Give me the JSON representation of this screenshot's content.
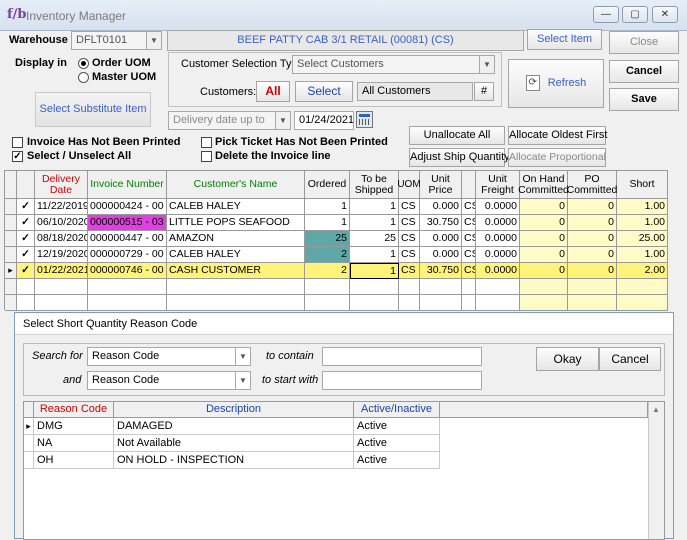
{
  "window": {
    "logo": "f/b",
    "title": "Inventory Manager",
    "minimize": "—",
    "maximize": "▢",
    "close": "✕"
  },
  "warehouse": {
    "label": "Warehouse",
    "value": "DFLT0101"
  },
  "item_title": "BEEF PATTY CAB 3/1 RETAIL (00081) (CS)",
  "buttons": {
    "select_item": "Select Item",
    "close": "Close",
    "cancel": "Cancel",
    "save": "Save",
    "refresh": "Refresh",
    "select_substitute": "Select Substitute Item",
    "unallocate_all": "Unallocate All",
    "allocate_oldest": "Allocate Oldest First",
    "adjust_ship_qty": "Adjust Ship Quantity",
    "allocate_proportional": "Allocate Proportional",
    "all": "All",
    "select": "Select",
    "hash": "#"
  },
  "display_in": {
    "label": "Display in",
    "opt1": "Order UOM",
    "opt2": "Master UOM"
  },
  "customer_selection": {
    "label": "Customer Selection Type",
    "value": "Select Customers"
  },
  "customers": {
    "label": "Customers:",
    "value": "All Customers"
  },
  "delivery_date": {
    "placeholder": "Delivery date up to",
    "value": "01/24/2021"
  },
  "checks": {
    "invoice_not_printed": "Invoice Has Not Been Printed",
    "select_unselect_all": "Select / Unselect All",
    "pick_ticket_not_printed": "Pick Ticket Has Not Been Printed",
    "delete_invoice_line": "Delete the Invoice line"
  },
  "grid": {
    "headers": {
      "delivery_date": "Delivery Date",
      "invoice_number": "Invoice Number",
      "customer_name": "Customer's Name",
      "ordered": "Ordered",
      "to_be_shipped": "To be Shipped",
      "uom": "UOM",
      "unit_price": "Unit Price",
      "unit_freight": "Unit Freight",
      "on_hand_committed": "On Hand Committed",
      "po_committed": "PO Committed",
      "short": "Short"
    },
    "rows": [
      {
        "check": "✓",
        "date": "11/22/2019",
        "invoice": "000000424 - 00",
        "customer": "CALEB HALEY",
        "ordered": "1",
        "ship": "1",
        "uom": "CS",
        "price": "0.000",
        "puom": "CS",
        "freight": "0.0000",
        "onhand": "0",
        "po": "0",
        "short": "1.00"
      },
      {
        "check": "✓",
        "date": "06/10/2020",
        "invoice": "000000515 - 03",
        "customer": "LITTLE POPS SEAFOOD",
        "ordered": "1",
        "ship": "1",
        "uom": "CS",
        "price": "30.750",
        "puom": "CS",
        "freight": "0.0000",
        "onhand": "0",
        "po": "0",
        "short": "1.00"
      },
      {
        "check": "✓",
        "date": "08/18/2020",
        "invoice": "000000447 - 00",
        "customer": "AMAZON",
        "ordered": "25",
        "ship": "25",
        "uom": "CS",
        "price": "0.000",
        "puom": "CS",
        "freight": "0.0000",
        "onhand": "0",
        "po": "0",
        "short": "25.00"
      },
      {
        "check": "✓",
        "date": "12/19/2020",
        "invoice": "000000729 - 00",
        "customer": "CALEB HALEY",
        "ordered": "2",
        "ship": "1",
        "uom": "CS",
        "price": "0.000",
        "puom": "CS",
        "freight": "0.0000",
        "onhand": "0",
        "po": "0",
        "short": "1.00"
      },
      {
        "check": "✓",
        "date": "01/22/2021",
        "invoice": "000000746 - 00",
        "customer": "CASH CUSTOMER",
        "ordered": "2",
        "ship": "1",
        "uom": "CS",
        "price": "30.750",
        "puom": "CS",
        "freight": "0.0000",
        "onhand": "0",
        "po": "0",
        "short": "2.00"
      }
    ]
  },
  "dialog": {
    "title": "Select Short Quantity Reason Code",
    "search_for": "Search for",
    "field1": "Reason Code",
    "to_contain": "to contain",
    "and": "and",
    "field2": "Reason Code",
    "to_start_with": "to start with",
    "ok": "Okay",
    "cancel": "Cancel",
    "headers": {
      "code": "Reason Code",
      "description": "Description",
      "active": "Active/Inactive"
    },
    "rows": [
      {
        "code": "DMG",
        "description": "DAMAGED",
        "active": "Active"
      },
      {
        "code": "NA",
        "description": "Not Available",
        "active": "Active"
      },
      {
        "code": "OH",
        "description": "ON HOLD - INSPECTION",
        "active": "Active"
      }
    ]
  },
  "colors": {
    "red": "#d40000",
    "green": "#008000",
    "blue": "#0000c0",
    "yellow": "#fff37a",
    "pale_yellow": "#fffbc6",
    "teal": "#5fa8a8",
    "magenta": "#e040e0"
  }
}
